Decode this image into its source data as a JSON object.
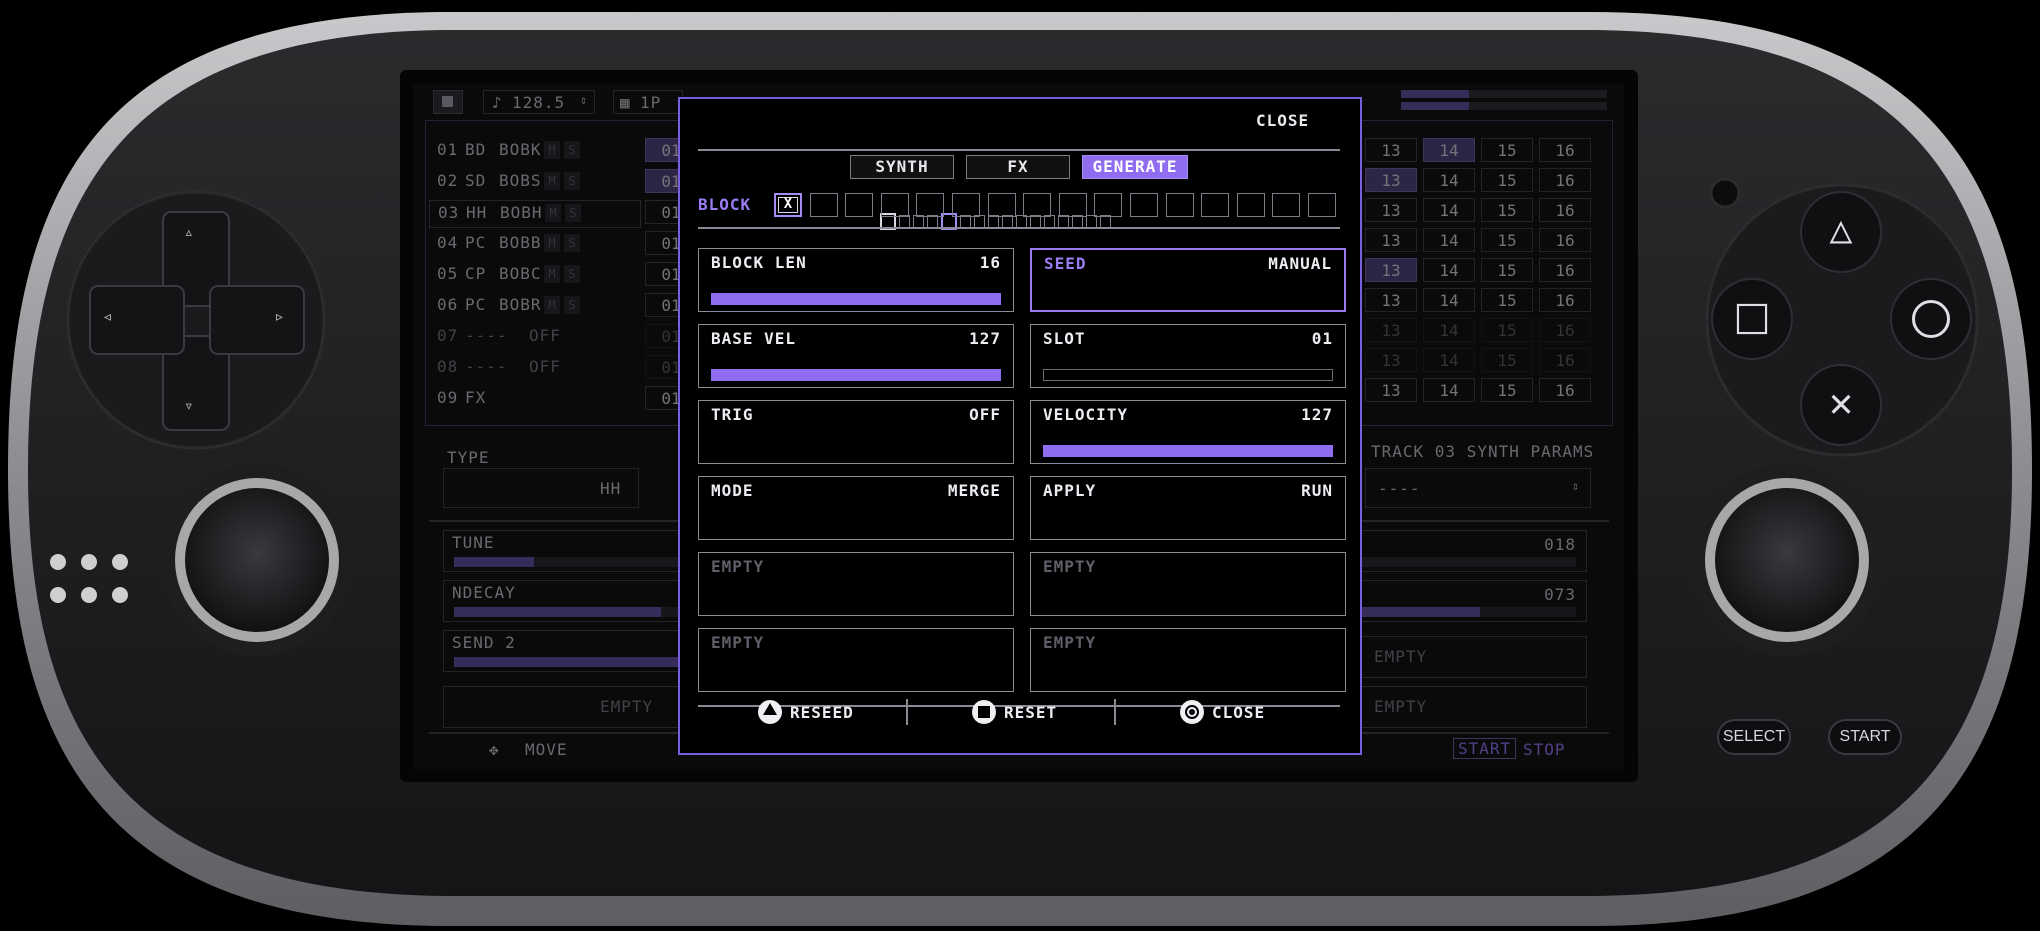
{
  "header": {
    "tempo": "128.5",
    "pattern": "1P"
  },
  "tracks": [
    {
      "id": "01",
      "name": "BD",
      "chain": "BOBK",
      "state": ""
    },
    {
      "id": "02",
      "name": "SD",
      "chain": "BOBS",
      "state": ""
    },
    {
      "id": "03",
      "name": "HH",
      "chain": "BOBH",
      "state": ""
    },
    {
      "id": "04",
      "name": "PC",
      "chain": "BOBB",
      "state": ""
    },
    {
      "id": "05",
      "name": "CP",
      "chain": "BOBC",
      "state": ""
    },
    {
      "id": "06",
      "name": "PC",
      "chain": "BOBR",
      "state": ""
    },
    {
      "id": "07",
      "name": "----",
      "chain": "",
      "state": "OFF"
    },
    {
      "id": "08",
      "name": "----",
      "chain": "",
      "state": "OFF"
    },
    {
      "id": "09",
      "name": "FX",
      "chain": "",
      "state": ""
    }
  ],
  "step_headers": [
    "13",
    "14",
    "15",
    "16"
  ],
  "mute_label": "M",
  "solo_label": "S",
  "step_start": "01",
  "type_panel": {
    "label": "TYPE",
    "value": "HH"
  },
  "params_panel": {
    "title": "TRACK 03  SYNTH PARAMS",
    "value": "----"
  },
  "bg_params": [
    {
      "label": "TUNE",
      "value": "018",
      "level": 0.27
    },
    {
      "label": "NDECAY",
      "value": "073",
      "level": 0.7
    },
    {
      "label": "SEND 2",
      "value": "EMPTY",
      "level": 0.78
    }
  ],
  "bg_empty": "EMPTY",
  "bg_footer": {
    "move": "MOVE",
    "start": "START",
    "stop": "STOP"
  },
  "modal": {
    "close_label": "CLOSE",
    "page_count": 16,
    "page_selected": 1,
    "page_current": 5,
    "tabs": [
      {
        "label": "SYNTH",
        "active": false
      },
      {
        "label": "FX",
        "active": false
      },
      {
        "label": "GENERATE",
        "active": true
      }
    ],
    "block_label": "BLOCK",
    "block_count": 16,
    "block_selected_mark": "X",
    "params": [
      {
        "label": "BLOCK LEN",
        "value": "16",
        "bar": 1.0,
        "selected": false,
        "empty": false
      },
      {
        "label": "SEED",
        "value": "MANUAL",
        "bar": null,
        "selected": true,
        "empty": false
      },
      {
        "label": "BASE VEL",
        "value": "127",
        "bar": 1.0,
        "selected": false,
        "empty": false
      },
      {
        "label": "SLOT",
        "value": "01",
        "bar": 0.0,
        "selected": false,
        "empty": false
      },
      {
        "label": "TRIG",
        "value": "OFF",
        "bar": null,
        "selected": false,
        "empty": false
      },
      {
        "label": "VELOCITY",
        "value": "127",
        "bar": 1.0,
        "selected": false,
        "empty": false
      },
      {
        "label": "MODE",
        "value": "MERGE",
        "bar": null,
        "selected": false,
        "empty": false
      },
      {
        "label": "APPLY",
        "value": "RUN",
        "bar": null,
        "selected": false,
        "empty": false
      },
      {
        "label": "EMPTY",
        "value": "",
        "bar": null,
        "selected": false,
        "empty": true
      },
      {
        "label": "EMPTY",
        "value": "",
        "bar": null,
        "selected": false,
        "empty": true
      },
      {
        "label": "EMPTY",
        "value": "",
        "bar": null,
        "selected": false,
        "empty": true
      },
      {
        "label": "EMPTY",
        "value": "",
        "bar": null,
        "selected": false,
        "empty": true
      }
    ],
    "footer": [
      {
        "label": "RESEED",
        "glyph": "triangle-icon"
      },
      {
        "label": "RESET",
        "glyph": "square-icon"
      },
      {
        "label": "CLOSE",
        "glyph": "circle-icon"
      }
    ]
  },
  "hardware": {
    "select_label": "SELECT",
    "start_label": "START"
  },
  "colors": {
    "accent": "#8f6cf0",
    "accent_light": "#a58cf5",
    "track_highlight": "#4a3d77"
  }
}
